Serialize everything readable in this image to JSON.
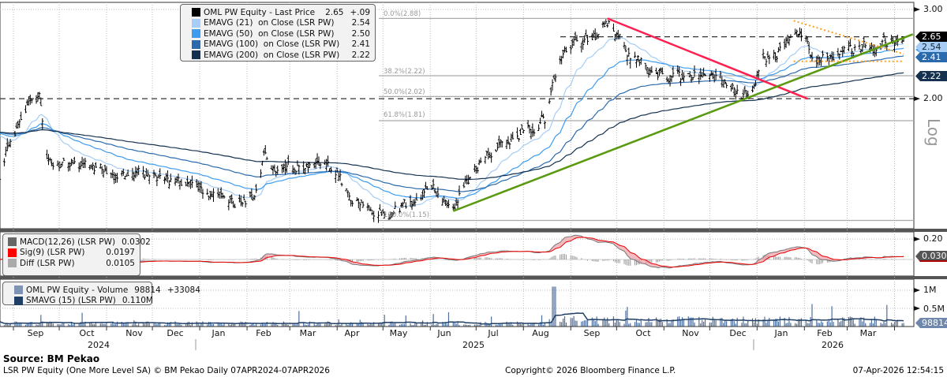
{
  "legend_main": {
    "rows": [
      {
        "name": "OML PW Equity - Last Price",
        "value": "2.65",
        "change": "+.09",
        "color": "#000000"
      },
      {
        "name": "EMAVG (21)  on Close (LSR PW)",
        "value": "2.54",
        "color": "#a6cdf5"
      },
      {
        "name": "EMAVG (50)  on Close (LSR PW)",
        "value": "2.50",
        "color": "#3d9cf0"
      },
      {
        "name": "EMAVG (100)  on Close (LSR PW)",
        "value": "2.41",
        "color": "#2a6aac"
      },
      {
        "name": "EMAVG (200)  on Close (LSR PW)",
        "value": "2.22",
        "color": "#14314f"
      }
    ]
  },
  "legend_macd": {
    "rows": [
      {
        "name": "MACD(12,26) (LSR PW)",
        "value": "0.0302",
        "color": "#666666"
      },
      {
        "name": "Sig(9) (LSR PW)",
        "value": "0.0197",
        "color": "#ff0000"
      },
      {
        "name": "Diff (LSR PW)",
        "value": "0.0105",
        "color": "#aaaaaa"
      }
    ]
  },
  "legend_volume": {
    "rows": [
      {
        "name": "OML PW Equity - Volume",
        "value": "98814",
        "change": "+33084",
        "color": "#7f93b5"
      },
      {
        "name": "SMAVG (15) (LSR PW)",
        "value": "0.110M",
        "color": "#1f3f66"
      }
    ]
  },
  "axis": {
    "price_ticks": [
      "3.00",
      "2.00"
    ],
    "scale_label": "Log",
    "macd_ticks": [
      "0.20"
    ],
    "volume_ticks": [
      "1M",
      "0.5M"
    ],
    "months": [
      "Sep",
      "Oct",
      "Nov",
      "Dec",
      "Jan",
      "Feb",
      "Mar",
      "Apr",
      "May",
      "Jun",
      "Jul",
      "Aug",
      "Sep",
      "Oct",
      "Nov",
      "Dec",
      "Jan",
      "Feb",
      "Mar"
    ],
    "years": [
      "2024",
      "2025",
      "2026"
    ]
  },
  "tags": {
    "price": "2.65",
    "ema21": "2.54",
    "ema50": "2.50",
    "ema100": "2.41",
    "ema200": "2.22",
    "macd": "0.0302",
    "volume": "98814"
  },
  "fib_labels": [
    "0.0%(2.88)",
    "38.2%(2.22)",
    "50.0%(2.02)",
    "61.8%(1.81)",
    "100.0%(1.15)"
  ],
  "footer": {
    "source": "Source: BM Pekao",
    "left": "LSR PW Equity (One More Level SA) © BM Pekao Daily 07APR2024-07APR2026",
    "center": "Copyright© 2026 Bloomberg Finance L.P.",
    "right": "07-Apr-2026 12:54:15"
  },
  "chart_data": {
    "type": "line",
    "panels": [
      "price (OHLC bars, log scale)",
      "MACD",
      "volume"
    ],
    "price_scale": "log",
    "ylim": [
      1.1,
      3.05
    ],
    "grid": true,
    "legend_placement": "top-left",
    "price_closes": [
      [
        "2024-08-23",
        1.42
      ],
      [
        "2024-08-31",
        1.71
      ],
      [
        "2024-09-10",
        1.93
      ],
      [
        "2024-09-18",
        1.99
      ],
      [
        "2024-09-23",
        1.53
      ],
      [
        "2024-10-14",
        1.47
      ],
      [
        "2024-11-19",
        1.4
      ],
      [
        "2024-12-20",
        1.35
      ],
      [
        "2025-01-25",
        1.23
      ],
      [
        "2025-02-05",
        1.28
      ],
      [
        "2025-02-12",
        1.53
      ],
      [
        "2025-02-20",
        1.45
      ],
      [
        "2025-03-13",
        1.47
      ],
      [
        "2025-03-20",
        1.5
      ],
      [
        "2025-04-02",
        1.42
      ],
      [
        "2025-04-10",
        1.25
      ],
      [
        "2025-04-23",
        1.2
      ],
      [
        "2025-05-19",
        1.22
      ],
      [
        "2025-06-03",
        1.3
      ],
      [
        "2025-06-16",
        1.22
      ],
      [
        "2025-06-27",
        1.4
      ],
      [
        "2025-07-10",
        1.59
      ],
      [
        "2025-07-30",
        1.68
      ],
      [
        "2025-08-15",
        1.82
      ],
      [
        "2025-08-23",
        2.27
      ],
      [
        "2025-08-28",
        2.52
      ],
      [
        "2025-09-10",
        2.57
      ],
      [
        "2025-09-25",
        2.83
      ],
      [
        "2025-10-03",
        2.66
      ],
      [
        "2025-10-11",
        2.43
      ],
      [
        "2025-10-26",
        2.31
      ],
      [
        "2025-11-05",
        2.19
      ],
      [
        "2025-11-21",
        2.22
      ],
      [
        "2025-12-12",
        2.14
      ],
      [
        "2025-12-22",
        2.04
      ],
      [
        "2025-12-30",
        2.11
      ],
      [
        "2026-01-04",
        2.4
      ],
      [
        "2026-01-17",
        2.52
      ],
      [
        "2026-01-25",
        2.76
      ],
      [
        "2026-01-30",
        2.62
      ],
      [
        "2026-02-07",
        2.43
      ],
      [
        "2026-02-22",
        2.43
      ],
      [
        "2026-03-10",
        2.51
      ],
      [
        "2026-03-20",
        2.57
      ],
      [
        "2026-03-30",
        2.62
      ],
      [
        "2026-04-07",
        2.65
      ]
    ],
    "fibonacci": [
      {
        "level": "0.0%",
        "value": 2.88
      },
      {
        "level": "38.2%",
        "value": 2.22
      },
      {
        "level": "50.0%",
        "value": 2.02
      },
      {
        "level": "61.8%",
        "value": 1.81
      },
      {
        "level": "100.0%",
        "value": 1.15
      }
    ],
    "horizontal_levels": [
      2.0,
      2.65
    ],
    "trendlines": [
      {
        "color": "#ff2050",
        "from": [
          "2025-09-25",
          2.88
        ],
        "to": [
          "2026-02-03",
          2.0
        ]
      },
      {
        "color": "#5a9a10",
        "from": [
          "2025-06-16",
          1.2
        ],
        "to": [
          "2026-04-13",
          2.68
        ]
      },
      {
        "color": "#ffa020",
        "style": "dotted",
        "from": [
          "2026-01-25",
          2.85
        ],
        "to": [
          "2026-04-07",
          2.45
        ]
      },
      {
        "color": "#ffa020",
        "style": "dotted",
        "from": [
          "2026-01-25",
          2.37
        ],
        "to": [
          "2026-04-07",
          2.37
        ]
      }
    ],
    "macd_ylim": [
      -0.1,
      0.22
    ],
    "volume_ylim": [
      0,
      1300000
    ]
  }
}
